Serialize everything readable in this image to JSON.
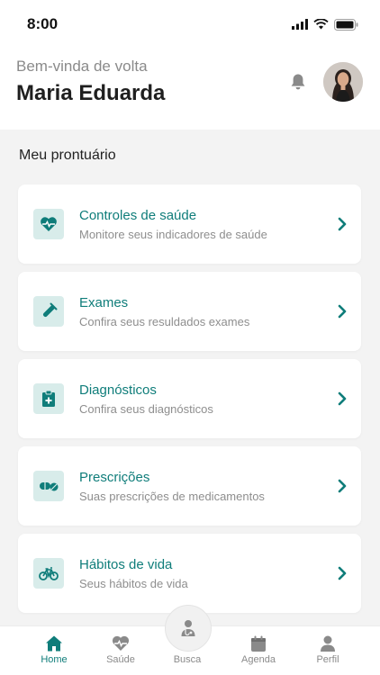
{
  "status_bar": {
    "time": "8:00"
  },
  "header": {
    "greeting": "Bem-vinda de volta",
    "username": "Maria Eduarda",
    "bell_icon": "bell-icon",
    "avatar_icon": "user-avatar"
  },
  "section": {
    "title": "Meu prontuário"
  },
  "colors": {
    "accent": "#0f7d7a",
    "icon_bg": "#d8ecea",
    "background": "#f3f3f3"
  },
  "cards": [
    {
      "title": "Controles de saúde",
      "subtitle": "Monitore seus indicadores de saúde",
      "icon": "heart-pulse-icon"
    },
    {
      "title": "Exames",
      "subtitle": "Confira seus resuldados exames",
      "icon": "test-tube-icon"
    },
    {
      "title": "Diagnósticos",
      "subtitle": "Confira seus diagnósticos",
      "icon": "clipboard-plus-icon"
    },
    {
      "title": "Prescrições",
      "subtitle": "Suas prescrições de medicamentos",
      "icon": "pill-icon"
    },
    {
      "title": "Hábitos de vida",
      "subtitle": "Seus hábitos de vida",
      "icon": "bicycle-icon"
    }
  ],
  "tabbar": {
    "items": [
      {
        "label": "Home",
        "icon": "home-icon",
        "active": true
      },
      {
        "label": "Saúde",
        "icon": "heart-pulse-icon",
        "active": false
      },
      {
        "label": "Busca",
        "icon": "doctor-icon",
        "active": false
      },
      {
        "label": "Agenda",
        "icon": "calendar-icon",
        "active": false
      },
      {
        "label": "Perfil",
        "icon": "person-icon",
        "active": false
      }
    ]
  }
}
